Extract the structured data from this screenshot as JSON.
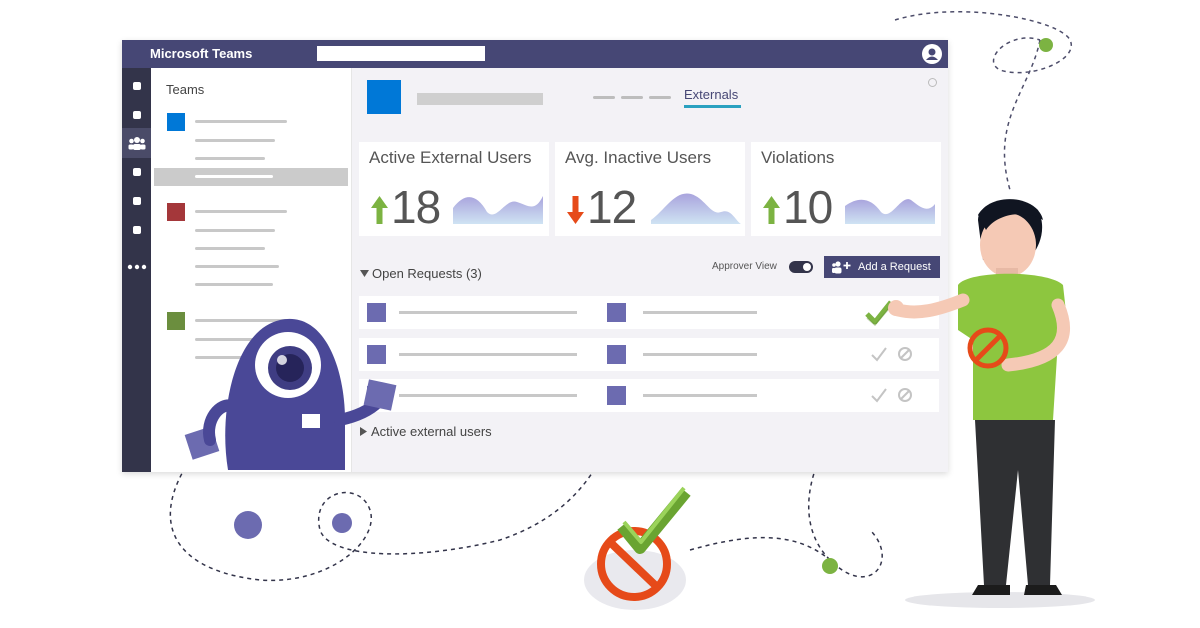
{
  "app": {
    "title": "Microsoft Teams"
  },
  "sidebar": {
    "heading": "Teams"
  },
  "main": {
    "tab_label": "Externals"
  },
  "stats": [
    {
      "title": "Active External Users",
      "value": "18",
      "trend": "up"
    },
    {
      "title": "Avg. Inactive Users",
      "value": "12",
      "trend": "down"
    },
    {
      "title": "Violations",
      "value": "10",
      "trend": "up"
    }
  ],
  "requests": {
    "section_label": "Open Requests (3)",
    "approver_label": "Approver View",
    "add_label": "Add a Request",
    "approver_view_on": true
  },
  "collapsed_section_label": "Active external users",
  "icons": [
    "profile-icon",
    "rail-icon",
    "people-icon",
    "arrow-up-icon",
    "arrow-down-icon",
    "check-icon",
    "block-icon",
    "add-person-icon",
    "caret-down-icon",
    "caret-right-icon"
  ],
  "colors": {
    "header": "#464775",
    "rail": "#33344a",
    "accent_blue": "#0078d7",
    "red_square": "#a4373a",
    "green_square": "#6b8e3e",
    "purple": "#6c6bb0",
    "arrow_up": "#7cb342",
    "arrow_down": "#e64a19",
    "tab_underline": "#2aa1c0"
  }
}
